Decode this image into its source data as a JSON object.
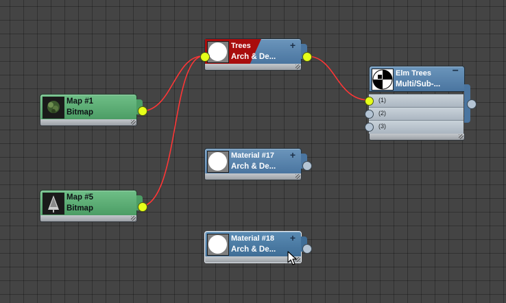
{
  "nodes": {
    "map1": {
      "title": "Map #1",
      "subtitle": "Bitmap"
    },
    "map5": {
      "title": "Map #5",
      "subtitle": "Bitmap"
    },
    "trees": {
      "title": "Trees",
      "subtitle": "Arch & De...",
      "expand_symbol": "+"
    },
    "material17": {
      "title": "Material #17",
      "subtitle": "Arch & De...",
      "expand_symbol": "+"
    },
    "material18": {
      "title": "Material #18",
      "subtitle": "Arch & De...",
      "expand_symbol": "+"
    },
    "elm_trees": {
      "title": "Elm Trees",
      "subtitle": "Multi/Sub-...",
      "collapse_symbol": "−",
      "slots": [
        {
          "label": "(1)"
        },
        {
          "label": "(2)"
        },
        {
          "label": "(3)"
        }
      ]
    }
  },
  "colors": {
    "wire": "#ff3030",
    "active_socket": "#e6ff1a",
    "bitmap_node": "#5aac73",
    "material_node": "#5a86b0",
    "trees_highlight": "#a90d0d"
  },
  "icons": {
    "cursor": "arrow-cursor-icon"
  }
}
